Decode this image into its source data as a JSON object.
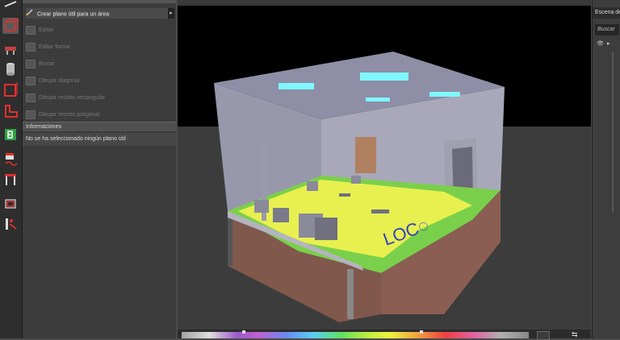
{
  "panel": {
    "create_plane_label": "Crear plano útil para un área",
    "disabled_items": [
      "Editar",
      "Editar forma",
      "Borrar",
      "Dibujar diagonal",
      "Dibujar recinto rectangular",
      "Dibujar recinto poligonal"
    ]
  },
  "info": {
    "title": "Informaciones",
    "message": "No se ha seleccionado ningún plano útil"
  },
  "right_panel": {
    "tab_label": "Escena de",
    "search_placeholder": "Buscar"
  },
  "viewport": {
    "floor_text": "LOC◌"
  },
  "colors": {
    "accent_green": "#2ea043",
    "floor_yellow": "#e8f050",
    "floor_green": "#7ad04a",
    "ceiling_light": "#7ff7ff"
  }
}
